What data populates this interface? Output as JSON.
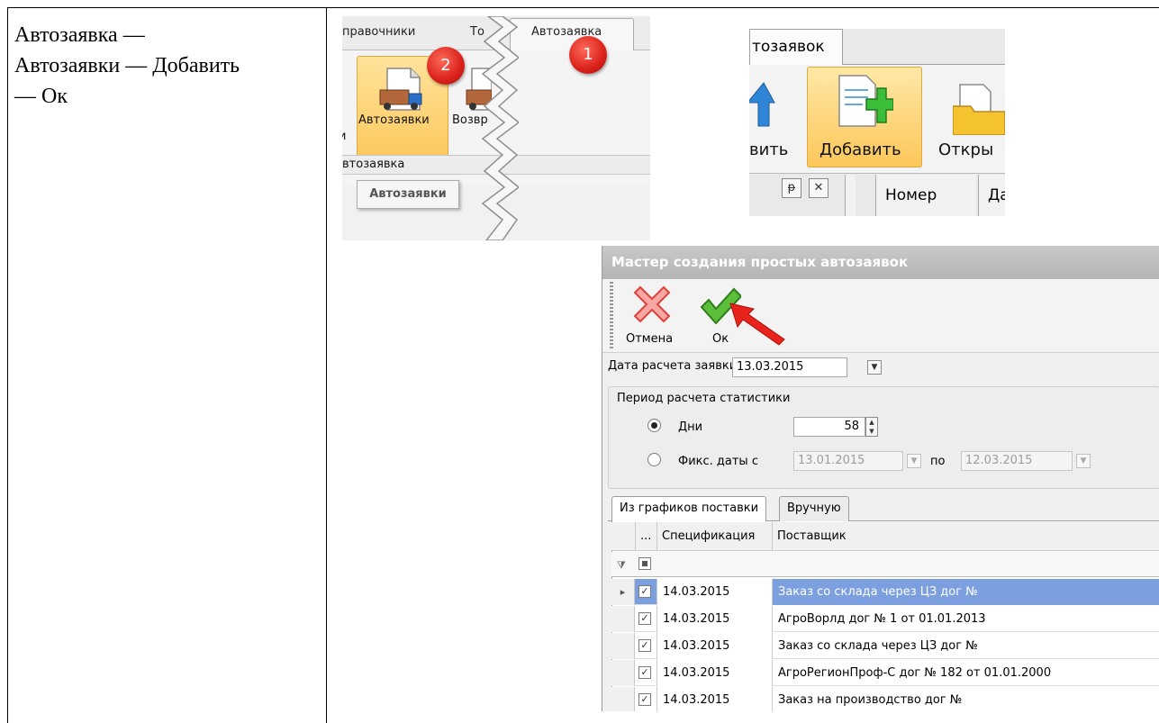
{
  "instruction": {
    "line1": "Автозаявка —",
    "line2": "Автозаявки — Добавить",
    "line3": "— Ок"
  },
  "ribbon_crop": {
    "tabs": [
      "правочники",
      "То",
      "Автозаявка"
    ],
    "button_autozayavki": "Автозаявки",
    "button_returns": "Возвр",
    "group_label": "втозаявка",
    "tooltip": "Автозаявки",
    "badge_1": "1",
    "badge_2": "2"
  },
  "toolbar_crop": {
    "tab": "тозаявок",
    "left_label": "вить",
    "add_label": "Добавить",
    "open_label": "Откры",
    "pin_glyph": "ᵽ",
    "close_glyph": "✕",
    "col_number": "Номер",
    "col_date": "Да"
  },
  "wizard": {
    "title": "Мастер создания простых автозаявок",
    "cancel_label": "Отмена",
    "ok_label": "Ок",
    "calc_date_label": "Дата расчета заявки",
    "calc_date_value": "13.03.2015",
    "period_group_label": "Период расчета статистики",
    "days_label": "Дни",
    "days_value": "58",
    "fixed_dates_label": "Фикс. даты с",
    "date_from": "13.01.2015",
    "to_label": "по",
    "date_to": "12.03.2015",
    "tabs": [
      "Из графиков поставки",
      "Вручную"
    ],
    "columns": [
      "...",
      "Спецификация",
      "Поставщик"
    ],
    "rows": [
      {
        "spec": "14.03.2015",
        "supplier": "Заказ со склада через ЦЗ дог №",
        "selected": true
      },
      {
        "spec": "14.03.2015",
        "supplier": "АгроВорлд дог № 1 от 01.01.2013",
        "selected": false
      },
      {
        "spec": "14.03.2015",
        "supplier": "Заказ со склада через ЦЗ дог №",
        "selected": false
      },
      {
        "spec": "14.03.2015",
        "supplier": "АгроРегионПроф-С дог № 182 от 01.01.2000",
        "selected": false
      },
      {
        "spec": "14.03.2015",
        "supplier": "Заказ на производство дог №",
        "selected": false
      }
    ]
  },
  "colors": {
    "selection": "#7c9fe0",
    "highlight_button": "#fcc75a",
    "badge_red": "#d9211b",
    "arrow_red": "#e8231c"
  }
}
